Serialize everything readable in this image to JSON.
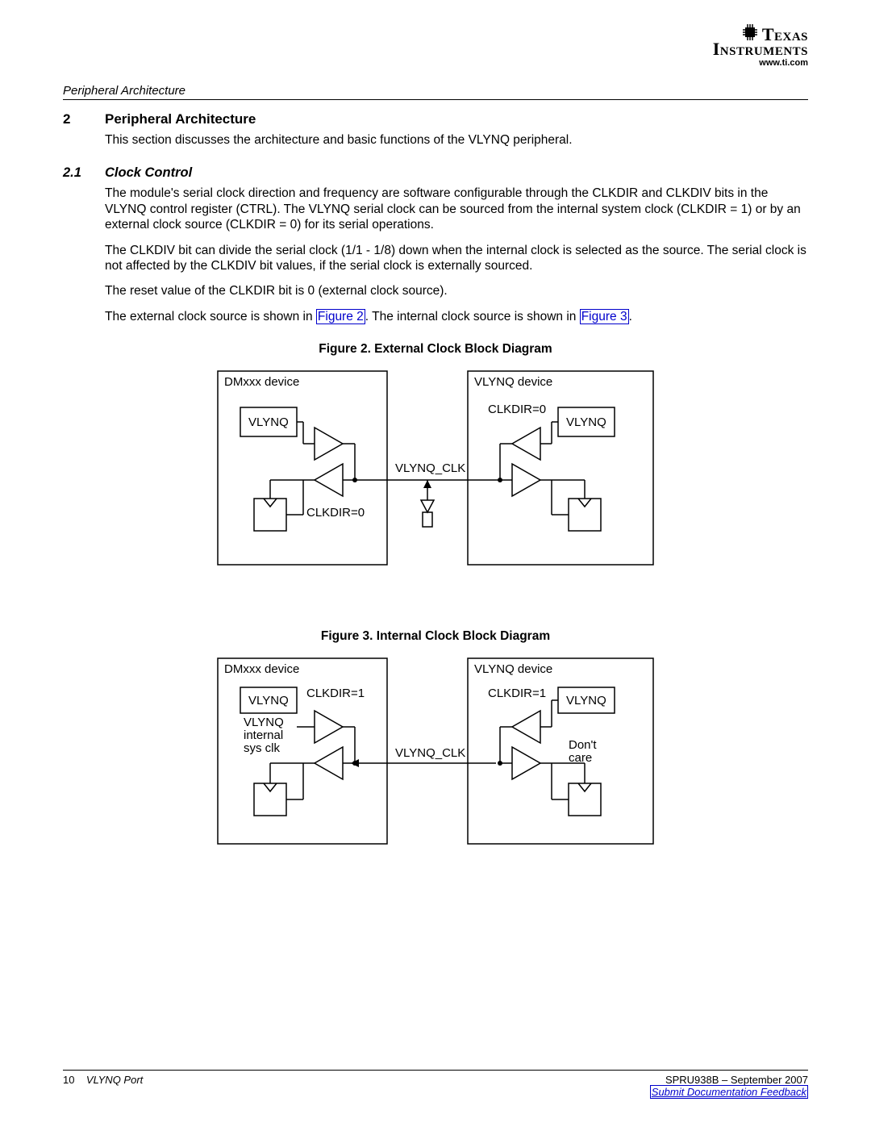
{
  "header": {
    "brand_texas": "Texas",
    "brand_instruments": "Instruments",
    "url": "www.ti.com",
    "running_head": "Peripheral Architecture"
  },
  "section2": {
    "num": "2",
    "title": "Peripheral Architecture",
    "intro": "This section discusses the architecture and basic functions of the VLYNQ peripheral."
  },
  "section21": {
    "num": "2.1",
    "title": "Clock Control",
    "p1": "The module's serial clock direction and frequency are software configurable through the CLKDIR and CLKDIV bits in the VLYNQ control register (CTRL). The VLYNQ serial clock can be sourced from the internal system clock (CLKDIR = 1) or by an external clock source (CLKDIR = 0) for its serial operations.",
    "p2": "The CLKDIV bit can divide the serial clock (1/1 - 1/8) down when the internal clock is selected as the source. The serial clock is not affected by the CLKDIV bit values, if the serial clock is externally sourced.",
    "p3": "The reset value of the CLKDIR bit is 0 (external clock source).",
    "p4a": "The external clock source is shown in ",
    "p4_link1": "Figure 2",
    "p4b": ". The internal clock source is shown in ",
    "p4_link2": "Figure 3",
    "p4c": "."
  },
  "figure2": {
    "caption": "Figure 2. External Clock Block Diagram",
    "left_device": "DMxxx device",
    "right_device": "VLYNQ device",
    "left_module": "VLYNQ",
    "right_module": "VLYNQ",
    "left_clkdir": "CLKDIR=0",
    "right_clkdir": "CLKDIR=0",
    "signal": "VLYNQ_CLK"
  },
  "figure3": {
    "caption": "Figure 3. Internal Clock Block Diagram",
    "left_device": "DMxxx device",
    "right_device": "VLYNQ device",
    "left_module": "VLYNQ",
    "right_module": "VLYNQ",
    "left_clkdir": "CLKDIR=1",
    "right_clkdir": "CLKDIR=1",
    "left_clk_src1": "VLYNQ",
    "left_clk_src2": "internal",
    "left_clk_src3": "sys clk",
    "right_note1": "Don't",
    "right_note2": "care",
    "signal": "VLYNQ_CLK"
  },
  "footer": {
    "page": "10",
    "title": "VLYNQ Port",
    "docid": "SPRU938B – September 2007",
    "feedback": "Submit Documentation Feedback"
  }
}
